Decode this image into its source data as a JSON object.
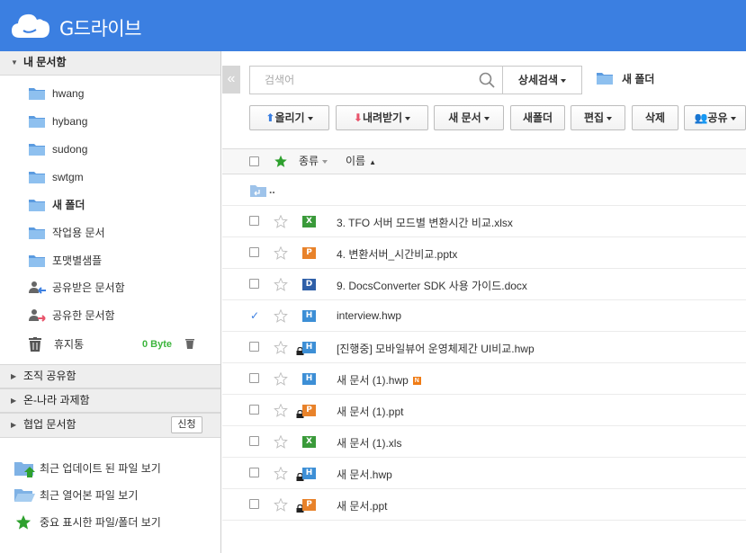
{
  "app": {
    "title": "G드라이브"
  },
  "sidebar": {
    "my_docs": "내 문서함",
    "folders": [
      "hwang",
      "hybang",
      "sudong",
      "swtgm",
      "새 폴더",
      "작업용 문서",
      "포맷별샘플"
    ],
    "shared_received": "공유받은 문서함",
    "shared_sent": "공유한 문서함",
    "trash": "휴지통",
    "trash_size": "0 Byte",
    "org_share": "조직 공유함",
    "onnara": "온-나라 과제함",
    "collab": "협업 문서함",
    "apply": "신청",
    "quick_links": [
      "최근 업데이트 된 파일 보기",
      "최근 열어본 파일 보기",
      "중요 표시한 파일/폴더 보기"
    ]
  },
  "search": {
    "placeholder": "검색어",
    "advanced": "상세검색"
  },
  "current_folder": "새 폴더",
  "toolbar": {
    "upload": "올리기",
    "download": "내려받기",
    "new_doc": "새 문서",
    "new_folder": "새폴더",
    "edit": "편집",
    "delete": "삭제",
    "share": "공유"
  },
  "columns": {
    "type": "종류",
    "name": "이름"
  },
  "parent_dir": "..",
  "files": [
    {
      "name": "3. TFO 서버 모드별 변환시간 비교.xlsx",
      "type": "X",
      "color": "#3a9a3a",
      "locked": false,
      "checked": false,
      "new": false
    },
    {
      "name": "4. 변환서버_시간비교.pptx",
      "type": "P",
      "color": "#e8822a",
      "locked": false,
      "checked": false,
      "new": false
    },
    {
      "name": "9. DocsConverter SDK 사용 가이드.docx",
      "type": "D",
      "color": "#2f5fa8",
      "locked": false,
      "checked": false,
      "new": false
    },
    {
      "name": "interview.hwp",
      "type": "H",
      "color": "#3d8fd6",
      "locked": false,
      "checked": true,
      "new": false
    },
    {
      "name": "[진행중] 모바일뷰어 운영체제간 UI비교.hwp",
      "type": "H",
      "color": "#3d8fd6",
      "locked": true,
      "checked": false,
      "new": false
    },
    {
      "name": "새 문서 (1).hwp",
      "type": "H",
      "color": "#3d8fd6",
      "locked": false,
      "checked": false,
      "new": true,
      "new_badge": "N"
    },
    {
      "name": "새 문서 (1).ppt",
      "type": "P",
      "color": "#e8822a",
      "locked": true,
      "checked": false,
      "new": false
    },
    {
      "name": "새 문서 (1).xls",
      "type": "X",
      "color": "#3a9a3a",
      "locked": false,
      "checked": false,
      "new": false
    },
    {
      "name": "새 문서.hwp",
      "type": "H",
      "color": "#3d8fd6",
      "locked": true,
      "checked": false,
      "new": false
    },
    {
      "name": "새 문서.ppt",
      "type": "P",
      "color": "#e8822a",
      "locked": true,
      "checked": false,
      "new": false
    }
  ],
  "colors": {
    "brand": "#3b7fe1",
    "green": "#3db53d"
  }
}
